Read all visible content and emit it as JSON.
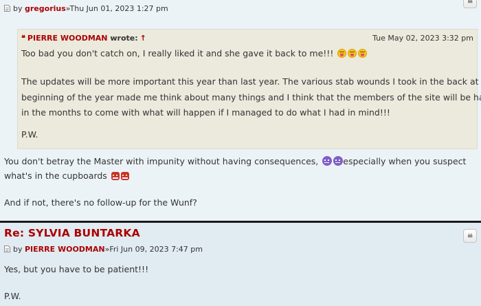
{
  "posts": [
    {
      "author": "gregorius",
      "separator": "»",
      "date": "Thu Jun 01, 2023 1:27 pm",
      "quote_button": "❝",
      "quote": {
        "author": "PIERRE WOODMAN",
        "wrote": "wrote:",
        "arrow": "↑",
        "date": "Tue May 02, 2023 3:32 pm",
        "lines": [
          "Too bad you don't catch on, I really liked it and she gave it back to me!!!",
          "The updates will be more important this year than last year. The various stab wounds I took in the back at the",
          "beginning of the year made me think about many things and I think that the members of the site will be happy",
          "in the months to come with what will happen if I managed to do what I had in mind!!!",
          "P.W."
        ],
        "emoji_icons": [
          "tongue-out-emoji",
          "tongue-out-emoji",
          "tongue-out-emoji"
        ]
      },
      "body": [
        "You don't betray the Master with impunity without having consequences,",
        "especially when you suspect",
        "what's in the cupboards",
        "And if not, there's no follow-up for the Wunf?"
      ],
      "emoji_icons": [
        "smiling-devil-emoji",
        "ogre-emoji"
      ]
    },
    {
      "title": "Re: SYLVIA BUNTARKA",
      "author": "PIERRE WOODMAN",
      "separator": "»",
      "date": "Fri Jun 09, 2023 7:47 pm",
      "quote_button": "❝",
      "body": [
        "Yes, but you have to be patient!!!",
        "P.W."
      ]
    }
  ],
  "colors": {
    "accent_red": "#aa0000",
    "post_bg_light": "#ecf3f7",
    "post_bg_alt": "#e1ebf2",
    "quote_bg": "#ebeadd",
    "text": "#333333",
    "separator": "#1a1a1a"
  },
  "icons": {
    "post_icon": "document-icon",
    "quote_icon": "quote-icon"
  }
}
